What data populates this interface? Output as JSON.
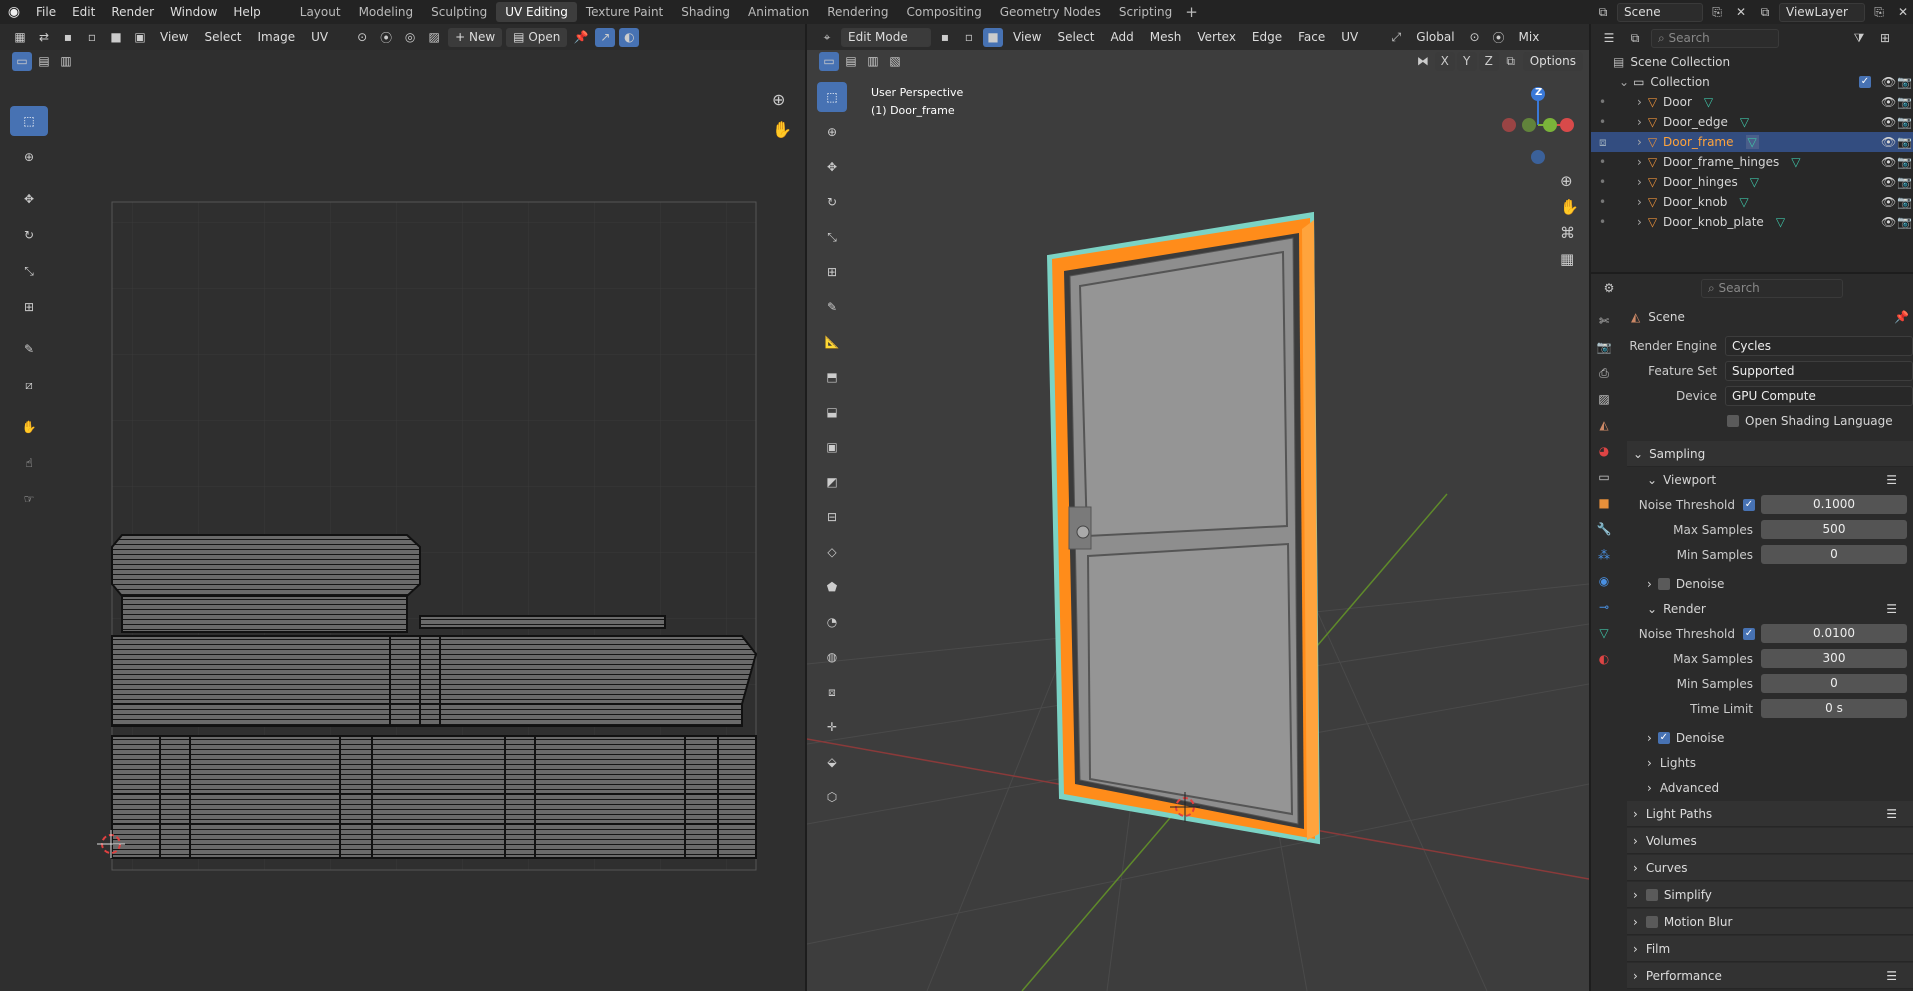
{
  "menu": [
    "File",
    "Edit",
    "Render",
    "Window",
    "Help"
  ],
  "workspaces": [
    "Layout",
    "Modeling",
    "Sculpting",
    "UV Editing",
    "Texture Paint",
    "Shading",
    "Animation",
    "Rendering",
    "Compositing",
    "Geometry Nodes",
    "Scripting"
  ],
  "active_workspace": "UV Editing",
  "scene_name": "Scene",
  "view_layer": "ViewLayer",
  "uv_editor": {
    "menus": [
      "View",
      "Select",
      "Image",
      "UV"
    ],
    "new_label": "New",
    "open_label": "Open"
  },
  "viewport": {
    "mode": "Edit Mode",
    "menus": [
      "View",
      "Select",
      "Add",
      "Mesh",
      "Vertex",
      "Edge",
      "Face",
      "UV"
    ],
    "transform_orientation": "Global",
    "shading_mix": "Mix",
    "axes": [
      "X",
      "Y",
      "Z"
    ],
    "options_label": "Options",
    "overlay_title": "User Perspective",
    "overlay_object": "(1) Door_frame",
    "gizmo_axis": "Z"
  },
  "outliner": {
    "search_placeholder": "Search",
    "scene_collection": "Scene Collection",
    "collection": "Collection",
    "items": [
      {
        "name": "Door",
        "selected": false
      },
      {
        "name": "Door_edge",
        "selected": false
      },
      {
        "name": "Door_frame",
        "selected": true
      },
      {
        "name": "Door_frame_hinges",
        "selected": false
      },
      {
        "name": "Door_hinges",
        "selected": false
      },
      {
        "name": "Door_knob",
        "selected": false
      },
      {
        "name": "Door_knob_plate",
        "selected": false
      }
    ]
  },
  "properties": {
    "search_placeholder": "Search",
    "context": "Scene",
    "render_engine_label": "Render Engine",
    "render_engine": "Cycles",
    "feature_set_label": "Feature Set",
    "feature_set": "Supported",
    "device_label": "Device",
    "device": "GPU Compute",
    "osl_label": "Open Shading Language",
    "sampling_label": "Sampling",
    "viewport_label": "Viewport",
    "noise_threshold_label": "Noise Threshold",
    "vp_noise_threshold": "0.1000",
    "max_samples_label": "Max Samples",
    "vp_max_samples": "500",
    "min_samples_label": "Min Samples",
    "vp_min_samples": "0",
    "denoise_label": "Denoise",
    "render_label": "Render",
    "r_noise_threshold": "0.0100",
    "r_max_samples": "300",
    "r_min_samples": "0",
    "time_limit_label": "Time Limit",
    "r_time_limit": "0 s",
    "lights_label": "Lights",
    "advanced_label": "Advanced",
    "panels": [
      "Light Paths",
      "Volumes",
      "Curves",
      "Simplify",
      "Motion Blur",
      "Film",
      "Performance"
    ]
  }
}
